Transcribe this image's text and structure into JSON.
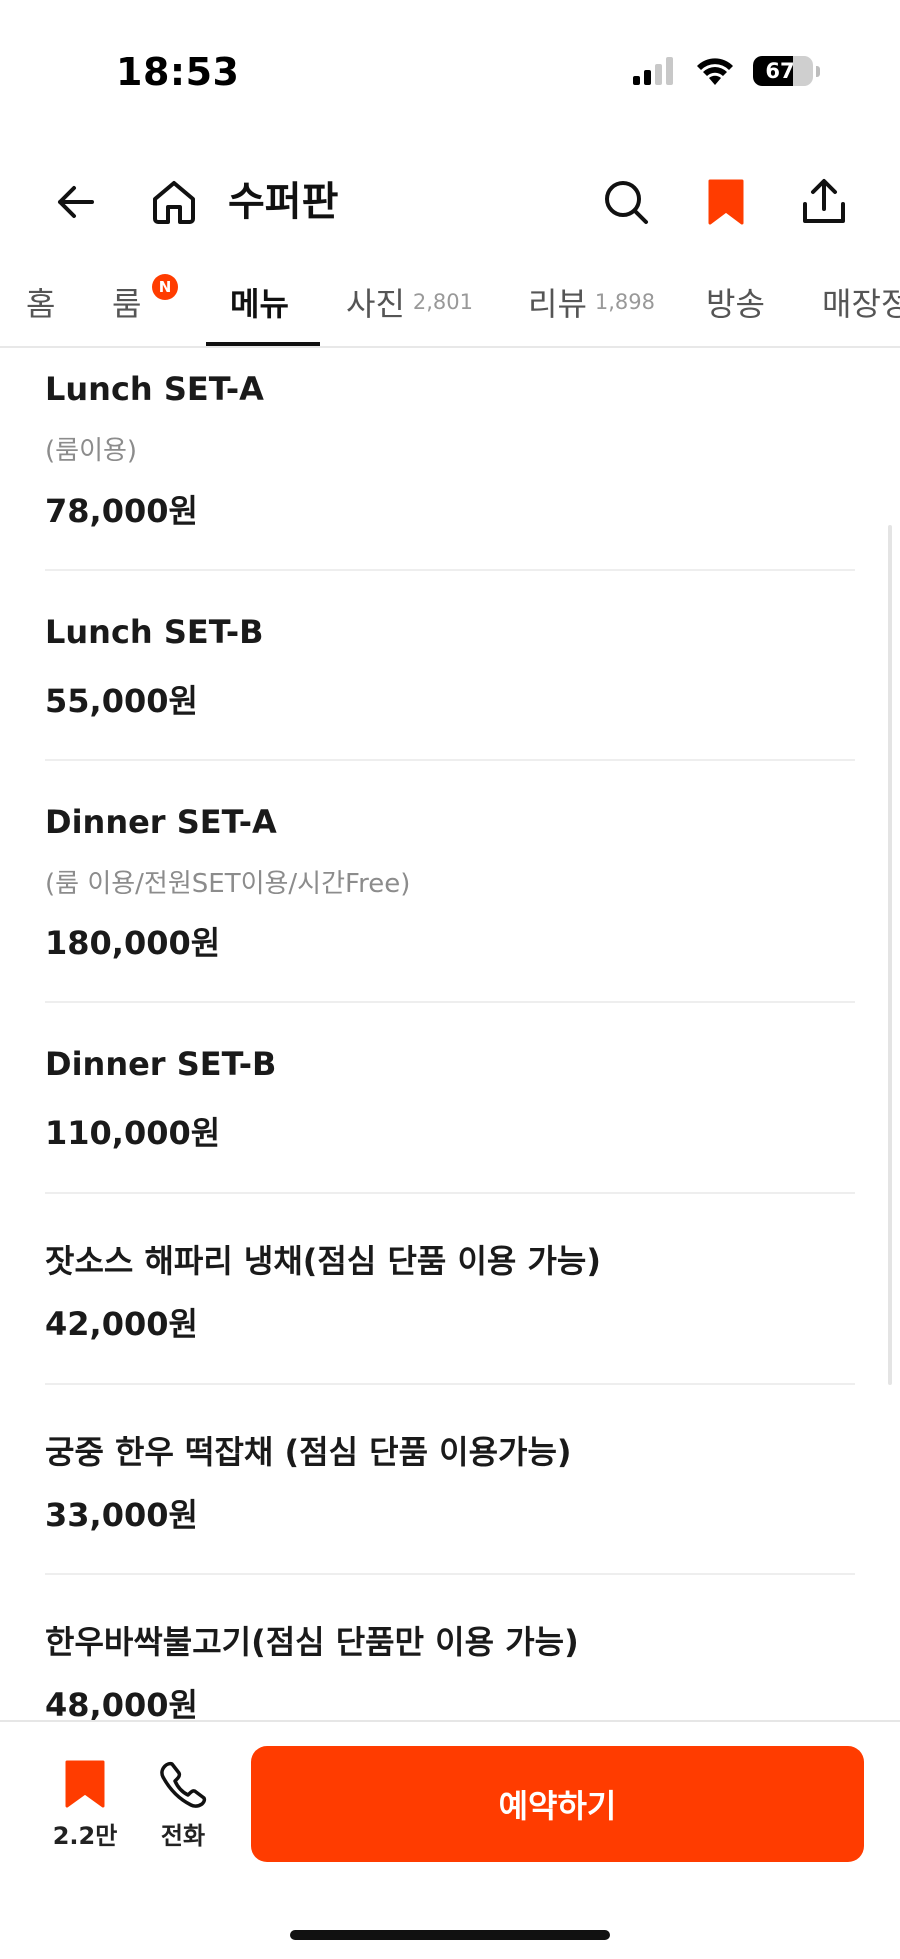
{
  "status_bar": {
    "time": "18:53",
    "battery_level": "67",
    "battery_fraction": 0.67
  },
  "header": {
    "title": "수퍼판"
  },
  "tabs": [
    {
      "label": "홈",
      "count": ""
    },
    {
      "label": "룸",
      "count": "",
      "badge": "N"
    },
    {
      "label": "메뉴",
      "count": "",
      "active": true
    },
    {
      "label": "사진",
      "count": "2,801"
    },
    {
      "label": "리뷰",
      "count": "1,898"
    },
    {
      "label": "방송",
      "count": ""
    },
    {
      "label": "매장정",
      "count": ""
    }
  ],
  "menu": {
    "items": [
      {
        "name": "Lunch SET-A",
        "desc": "(룸이용)",
        "price": "78,000원"
      },
      {
        "name": "Lunch SET-B",
        "desc": "",
        "price": "55,000원"
      },
      {
        "name": "Dinner SET-A",
        "desc": "(룸 이용/전원SET이용/시간Free)",
        "price": "180,000원"
      },
      {
        "name": "Dinner SET-B",
        "desc": "",
        "price": "110,000원"
      },
      {
        "name": "잣소스 해파리 냉채(점심 단품 이용 가능)",
        "desc": "",
        "price": "42,000원"
      },
      {
        "name": "궁중 한우 떡잡채 (점심 단품 이용가능)",
        "desc": "",
        "price": "33,000원"
      },
      {
        "name": "한우바싹불고기(점심 단품만 이용 가능)",
        "desc": "",
        "price": "48,000원"
      }
    ]
  },
  "bottom_bar": {
    "save_count": "2.2만",
    "call_label": "전화",
    "reserve_label": "예약하기"
  },
  "colors": {
    "accent": "#ff3c00",
    "text": "#1a1a1a",
    "muted": "#8c8c8c"
  },
  "icons": {
    "back": "arrow-left-icon",
    "home": "home-icon",
    "search": "search-icon",
    "bookmark": "bookmark-icon",
    "share": "share-icon",
    "phone": "phone-icon"
  }
}
